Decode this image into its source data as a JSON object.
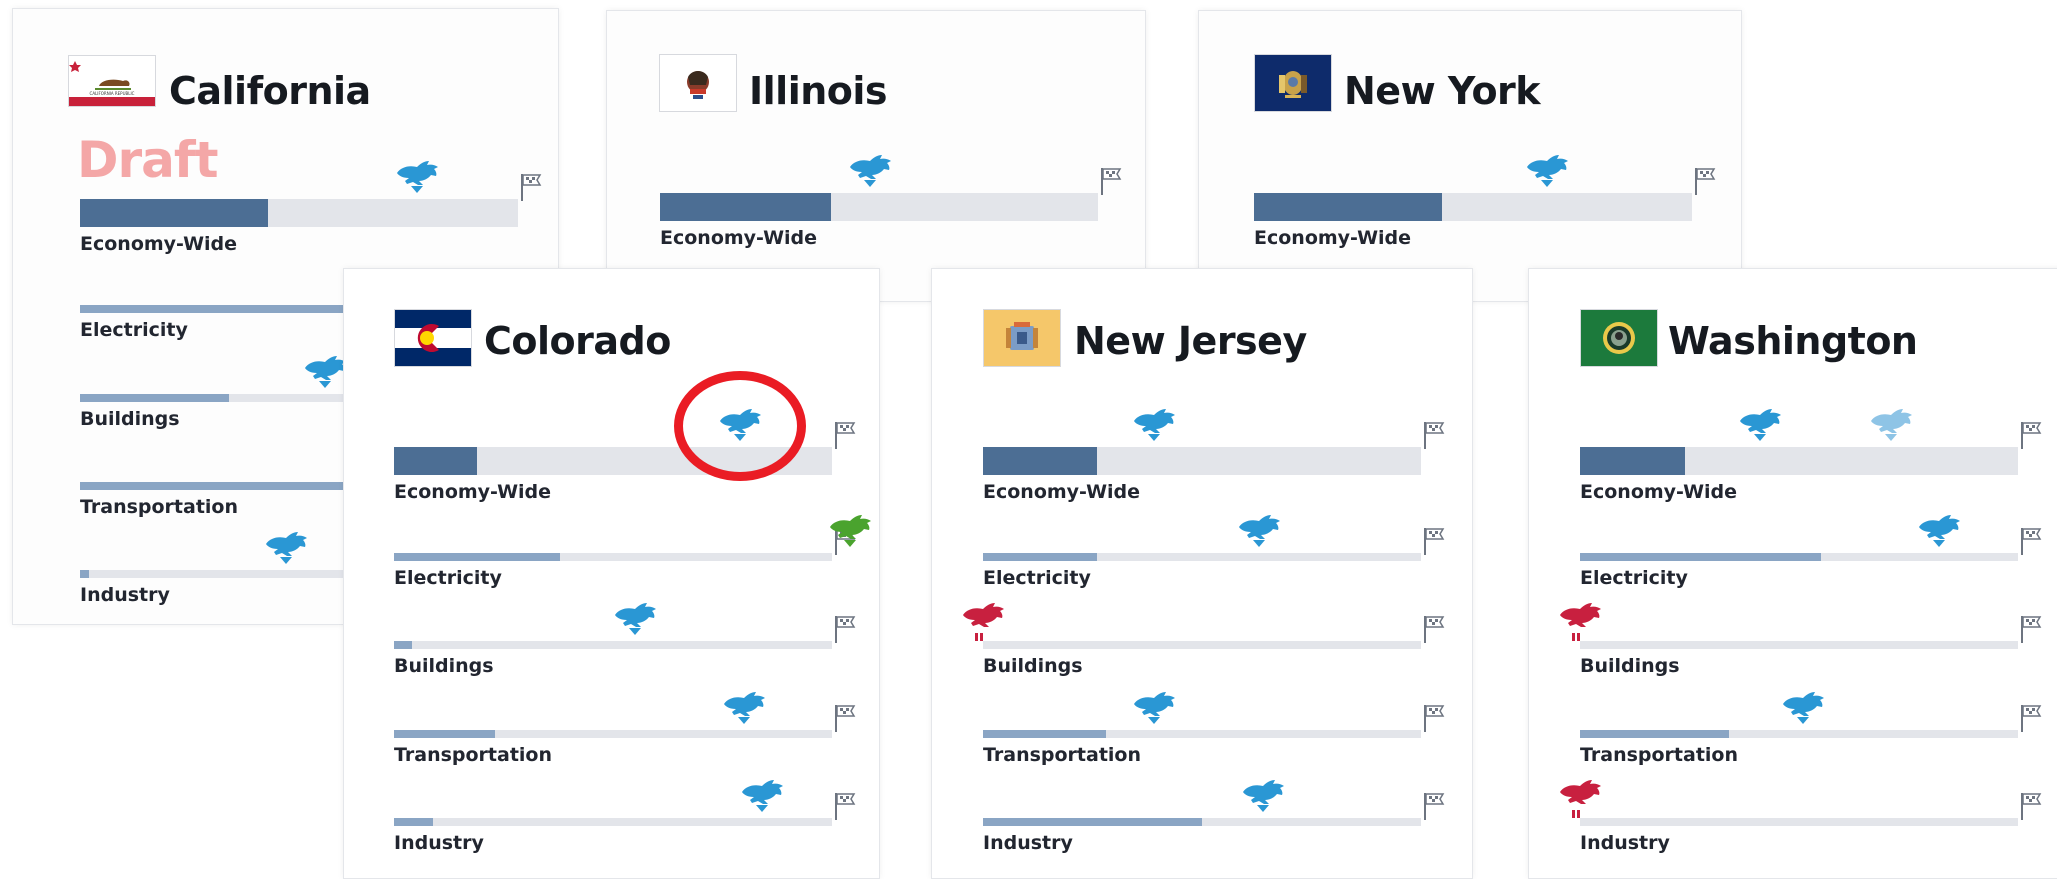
{
  "colors": {
    "fill_main": "#4c6e94",
    "fill_sector": "#8aa5c4",
    "track": "#e3e5ea",
    "rabbit_blue": "#2a97d4",
    "rabbit_lightblue": "#8ec4e6",
    "rabbit_green": "#4aa32e",
    "rabbit_red": "#c8203f",
    "goal_flag": "#6d7480",
    "draft": "#f4a7a7",
    "highlight": "#ea1c24"
  },
  "cards": [
    {
      "id": "california",
      "name": "California",
      "flag_icon": "california-flag-icon",
      "draft_label": "Draft",
      "rows": [
        {
          "label": "Economy-Wide",
          "progress": 0.43,
          "markers": [
            {
              "icon": "rabbit-icon",
              "color": "blue",
              "pos": 0.77
            }
          ]
        },
        {
          "label": "Electricity",
          "progress": 0.68,
          "markers": []
        },
        {
          "label": "Buildings",
          "progress": 0.34,
          "markers": [
            {
              "icon": "rabbit-icon",
              "color": "blue",
              "pos": 0.56
            }
          ]
        },
        {
          "label": "Transportation",
          "progress": 0.7,
          "markers": []
        },
        {
          "label": "Industry",
          "progress": 0.02,
          "markers": [
            {
              "icon": "rabbit-icon",
              "color": "blue",
              "pos": 0.47
            }
          ]
        }
      ]
    },
    {
      "id": "illinois",
      "name": "Illinois",
      "flag_icon": "illinois-flag-icon",
      "rows": [
        {
          "label": "Economy-Wide",
          "progress": 0.39,
          "markers": [
            {
              "icon": "rabbit-icon",
              "color": "blue",
              "pos": 0.48
            }
          ]
        }
      ]
    },
    {
      "id": "new-york",
      "name": "New York",
      "flag_icon": "new-york-flag-icon",
      "rows": [
        {
          "label": "Economy-Wide",
          "progress": 0.43,
          "markers": [
            {
              "icon": "rabbit-icon",
              "color": "blue",
              "pos": 0.67
            }
          ]
        }
      ]
    },
    {
      "id": "colorado",
      "name": "Colorado",
      "flag_icon": "colorado-flag-icon",
      "rows": [
        {
          "label": "Economy-Wide",
          "progress": 0.19,
          "markers": [
            {
              "icon": "rabbit-icon",
              "color": "blue",
              "pos": 0.79,
              "highlighted": true
            }
          ]
        },
        {
          "label": "Electricity",
          "progress": 0.38,
          "markers": [
            {
              "icon": "rabbit-icon",
              "color": "green",
              "pos": 1.04
            }
          ]
        },
        {
          "label": "Buildings",
          "progress": 0.04,
          "markers": [
            {
              "icon": "rabbit-icon",
              "color": "blue",
              "pos": 0.55
            }
          ]
        },
        {
          "label": "Transportation",
          "progress": 0.23,
          "markers": [
            {
              "icon": "rabbit-icon",
              "color": "blue",
              "pos": 0.8
            }
          ]
        },
        {
          "label": "Industry",
          "progress": 0.09,
          "markers": [
            {
              "icon": "rabbit-icon",
              "color": "blue",
              "pos": 0.84
            }
          ]
        }
      ]
    },
    {
      "id": "new-jersey",
      "name": "New Jersey",
      "flag_icon": "new-jersey-flag-icon",
      "rows": [
        {
          "label": "Economy-Wide",
          "progress": 0.26,
          "markers": [
            {
              "icon": "rabbit-icon",
              "color": "blue",
              "pos": 0.39
            }
          ]
        },
        {
          "label": "Electricity",
          "progress": 0.26,
          "markers": [
            {
              "icon": "rabbit-icon",
              "color": "blue",
              "pos": 0.63
            }
          ]
        },
        {
          "label": "Buildings",
          "progress": 0.0,
          "markers": [
            {
              "icon": "rabbit-icon",
              "color": "red",
              "pos": 0.0
            }
          ]
        },
        {
          "label": "Transportation",
          "progress": 0.28,
          "markers": [
            {
              "icon": "rabbit-icon",
              "color": "blue",
              "pos": 0.39
            }
          ]
        },
        {
          "label": "Industry",
          "progress": 0.5,
          "markers": [
            {
              "icon": "rabbit-icon",
              "color": "blue",
              "pos": 0.64
            }
          ]
        }
      ]
    },
    {
      "id": "washington",
      "name": "Washington",
      "flag_icon": "washington-flag-icon",
      "rows": [
        {
          "label": "Economy-Wide",
          "progress": 0.24,
          "markers": [
            {
              "icon": "rabbit-icon",
              "color": "blue",
              "pos": 0.41
            },
            {
              "icon": "rabbit-icon",
              "color": "lightblue",
              "pos": 0.71
            }
          ]
        },
        {
          "label": "Electricity",
          "progress": 0.55,
          "markers": [
            {
              "icon": "rabbit-icon",
              "color": "blue",
              "pos": 0.82
            }
          ]
        },
        {
          "label": "Buildings",
          "progress": 0.0,
          "markers": [
            {
              "icon": "rabbit-icon",
              "color": "red",
              "pos": 0.0
            }
          ]
        },
        {
          "label": "Transportation",
          "progress": 0.34,
          "markers": [
            {
              "icon": "rabbit-icon",
              "color": "blue",
              "pos": 0.51
            }
          ]
        },
        {
          "label": "Industry",
          "progress": 0.0,
          "markers": [
            {
              "icon": "rabbit-icon",
              "color": "red",
              "pos": 0.0
            }
          ]
        }
      ]
    }
  ]
}
